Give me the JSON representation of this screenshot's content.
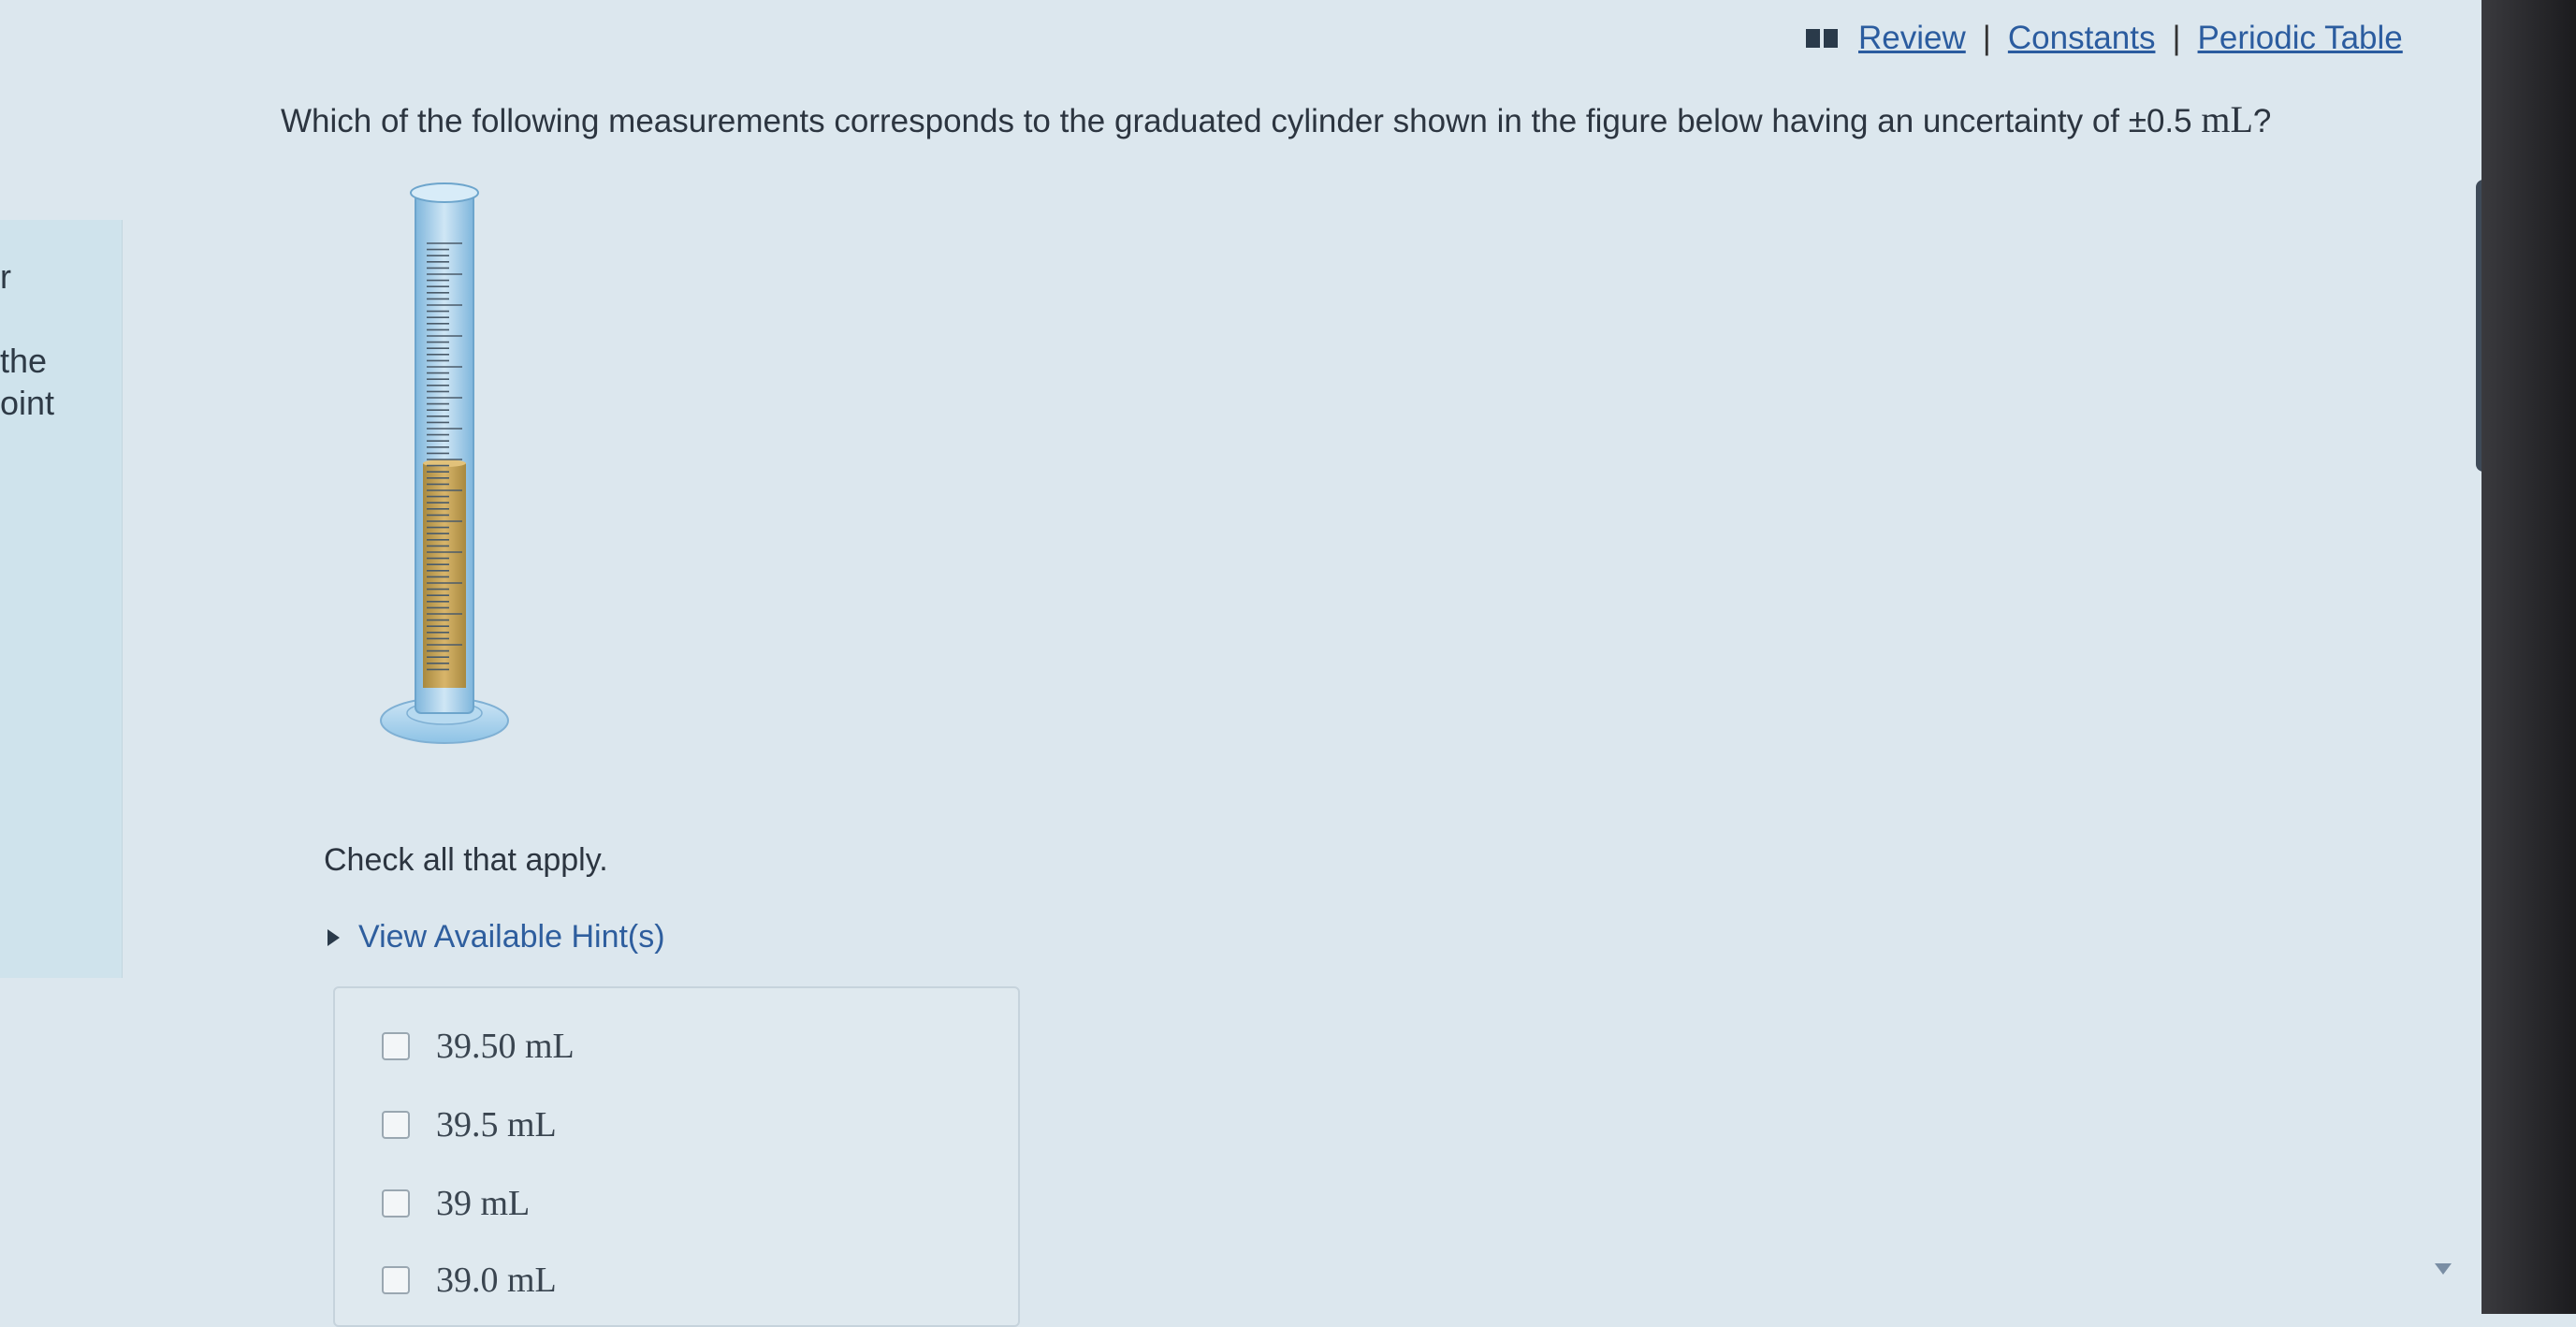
{
  "side_fragments": [
    "r",
    "the",
    "oint"
  ],
  "header": {
    "links": [
      "Review",
      "Constants",
      "Periodic Table"
    ],
    "separator": "|"
  },
  "question": {
    "prefix": "Which of the following measurements corresponds to the graduated cylinder shown in the figure below having an uncertainty of ±0.5",
    "unit": "mL",
    "suffix": "?"
  },
  "instructions": "Check all that apply.",
  "hint_label": "View Available Hint(s)",
  "options": [
    {
      "value": "39.50",
      "unit": "mL"
    },
    {
      "value": "39.5",
      "unit": "mL"
    },
    {
      "value": "39",
      "unit": "mL"
    },
    {
      "value": "39.0",
      "unit": "mL"
    }
  ],
  "colors": {
    "link": "#2b5c9f",
    "liquid": "#c7a25a",
    "cylinder": "#8ec3e6"
  }
}
